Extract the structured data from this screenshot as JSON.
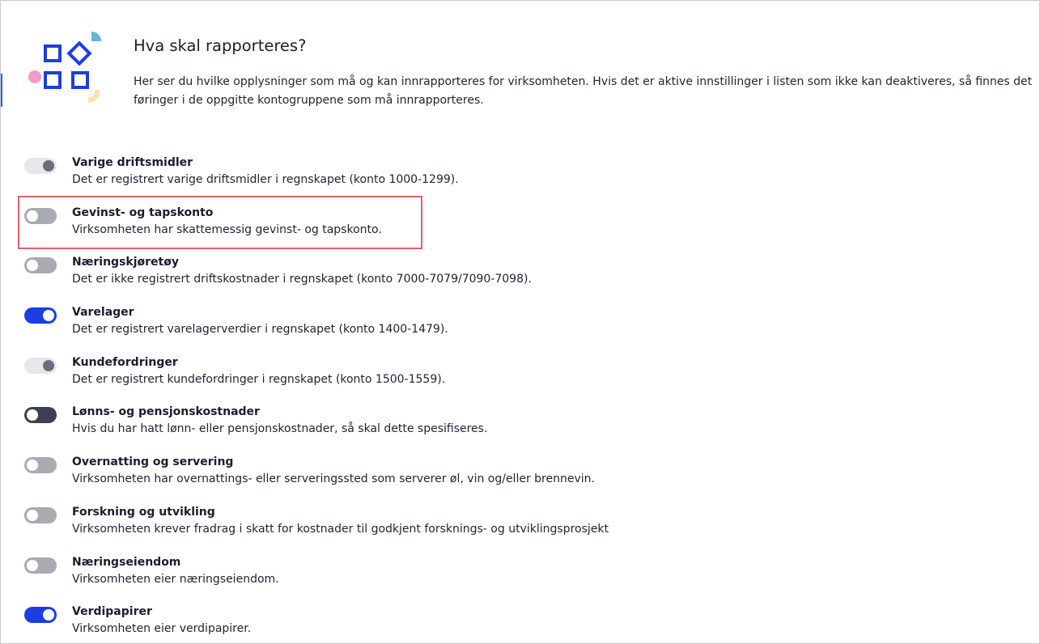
{
  "header": {
    "title": "Hva skal rapporteres?",
    "description": "Her ser du hvilke opplysninger som må og kan innrapporteres for virksomheten. Hvis det er aktive innstillinger i listen som ikke kan deaktiveres, så finnes det føringer i de oppgitte kontogruppene som må innrapporteres."
  },
  "colors": {
    "accent_blue": "#1a3fe0",
    "highlight_red": "#e0606c",
    "toggle_off": "#a9abb3",
    "toggle_locked": "#e6e7ea",
    "toggle_dark": "#3c4052"
  },
  "settings": [
    {
      "title": "Varige driftsmidler",
      "description": "Det er registrert varige driftsmidler i regnskapet (konto 1000-1299).",
      "state": "locked-on"
    },
    {
      "title": "Gevinst- og tapskonto",
      "description": "Virksomheten har skattemessig gevinst- og tapskonto.",
      "state": "off",
      "highlighted": true
    },
    {
      "title": "Næringskjøretøy",
      "description": "Det er ikke registrert driftskostnader i regnskapet (konto 7000-7079/7090-7098).",
      "state": "off"
    },
    {
      "title": "Varelager",
      "description": "Det er registrert varelagerverdier i regnskapet (konto 1400-1479).",
      "state": "on"
    },
    {
      "title": "Kundefordringer",
      "description": "Det er registrert kundefordringer i regnskapet (konto 1500-1559).",
      "state": "locked-on"
    },
    {
      "title": "Lønns- og pensjonskostnader",
      "description": "Hvis du har hatt lønn- eller pensjonskostnader, så skal dette spesifiseres.",
      "state": "dark-off"
    },
    {
      "title": "Overnatting og servering",
      "description": "Virksomheten har overnattings- eller serveringssted som serverer øl, vin og/eller brennevin.",
      "state": "off"
    },
    {
      "title": "Forskning og utvikling",
      "description": "Virksomheten krever fradrag i skatt for kostnader til godkjent forsknings- og utviklingsprosjekt",
      "state": "off"
    },
    {
      "title": "Næringseiendom",
      "description": "Virksomheten eier næringseiendom.",
      "state": "off"
    },
    {
      "title": "Verdipapirer",
      "description": "Virksomheten eier verdipapirer.",
      "state": "on"
    }
  ]
}
